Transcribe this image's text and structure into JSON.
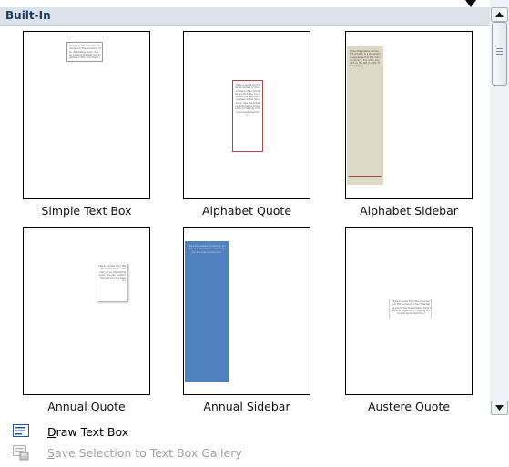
{
  "gallery": {
    "section_title": "Built-In",
    "items": [
      {
        "label": "Simple Text Box"
      },
      {
        "label": "Alphabet Quote"
      },
      {
        "label": "Alphabet Sidebar"
      },
      {
        "label": "Annual Quote"
      },
      {
        "label": "Annual Sidebar"
      },
      {
        "label": "Austere Quote"
      }
    ]
  },
  "menu": {
    "draw_text_box": {
      "accel": "D",
      "rest": "raw Text Box",
      "enabled": true
    },
    "save_selection": {
      "accel": "S",
      "rest": "ave Selection to Text Box Gallery",
      "enabled": false
    }
  },
  "colors": {
    "header_bg": "#dde3ea",
    "header_text": "#1f3a5a",
    "annual_sidebar_fill": "#4f81bd",
    "alphabet_quote_border": "#a24b4b",
    "alphabet_sidebar_fill": "#ddd9c4",
    "disabled_text": "#a0a0a0"
  },
  "icons": {
    "scroll_up": "triangle-up-icon",
    "scroll_down": "triangle-down-icon",
    "draw_text_box": "text-box-icon",
    "save_selection": "save-to-gallery-icon"
  }
}
